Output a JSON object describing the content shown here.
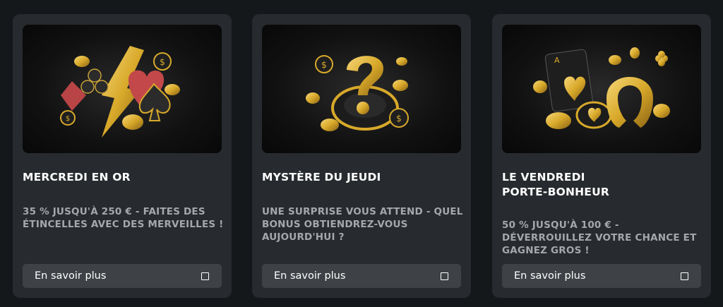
{
  "cards": [
    {
      "title": "MERCREDI EN OR",
      "description": "35 % JUSQU'À 250 € - FAITES DES ÉTINCELLES AVEC DES MERVEILLES !",
      "button_label": "En savoir plus",
      "button_icon": "square-icon",
      "image": "card-suits-lightning"
    },
    {
      "title": "MYSTÈRE DU JEUDI",
      "description": "UNE SURPRISE VOUS ATTEND - QUEL BONUS OBTIENDREZ-VOUS AUJOURD'HUI ?",
      "button_label": "En savoir plus",
      "button_icon": "square-icon",
      "image": "question-mark-chip"
    },
    {
      "title": "LE VENDREDI\nPORTE-BONHEUR",
      "description": "50 % JUSQU'À 100 € - DÉVERROUILLEZ VOTRE CHANCE ET GAGNEZ GROS !",
      "button_label": "En savoir plus",
      "button_icon": "square-icon",
      "image": "horseshoe-ace-clover"
    }
  ],
  "colors": {
    "background": "#15181b",
    "card": "#272a2e",
    "button": "#3e4246",
    "title": "#ffffff",
    "description": "#a4a8ad",
    "gold": "#d8a92a"
  }
}
